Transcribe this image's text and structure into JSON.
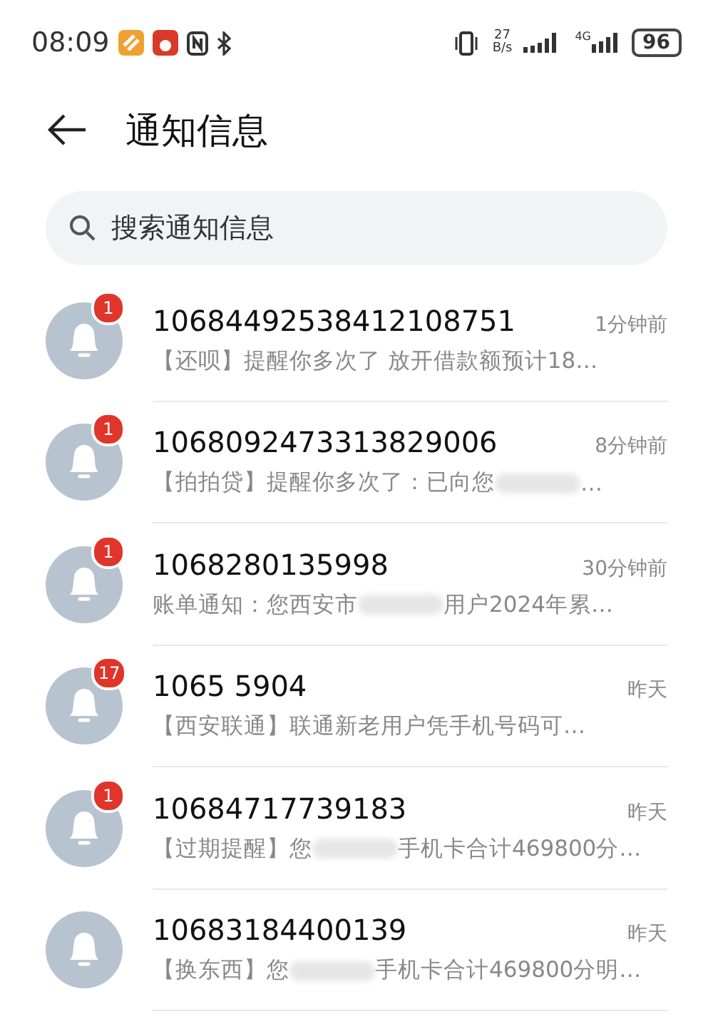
{
  "status_bar": {
    "time": "08:09",
    "net_speed_value": "27",
    "net_speed_unit": "B/s",
    "network_type": "4G",
    "battery": "96"
  },
  "header": {
    "title": "通知信息"
  },
  "search": {
    "placeholder": "搜索通知信息"
  },
  "messages": [
    {
      "sender": "10684492538412108751",
      "time": "1分钟前",
      "unread": "1",
      "preview": [
        {
          "kind": "text",
          "text": "【还呗】提醒你多次了 放开借款额预计18…"
        }
      ]
    },
    {
      "sender": "1068092473313829006",
      "time": "8分钟前",
      "unread": "1",
      "preview": [
        {
          "kind": "text",
          "text": "【拍拍贷】提醒你多次了：已向您"
        },
        {
          "kind": "blur"
        },
        {
          "kind": "text",
          "text": "…"
        }
      ]
    },
    {
      "sender": "1068280135998",
      "time": "30分钟前",
      "unread": "1",
      "preview": [
        {
          "kind": "text",
          "text": "账单通知：您西安市"
        },
        {
          "kind": "blur"
        },
        {
          "kind": "text",
          "text": "用户2024年累…"
        }
      ]
    },
    {
      "sender": "1065 5904",
      "time": "昨天",
      "unread": "17",
      "preview": [
        {
          "kind": "text",
          "text": "【西安联通】联通新老用户凭手机号码可…"
        }
      ]
    },
    {
      "sender": "10684717739183",
      "time": "昨天",
      "unread": "1",
      "preview": [
        {
          "kind": "text",
          "text": "【过期提醒】您"
        },
        {
          "kind": "blur"
        },
        {
          "kind": "text",
          "text": "手机卡合计469800分…"
        }
      ]
    },
    {
      "sender": "10683184400139",
      "time": "昨天",
      "preview": [
        {
          "kind": "text",
          "text": "【换东西】您"
        },
        {
          "kind": "blur"
        },
        {
          "kind": "text",
          "text": "手机卡合计469800分明…"
        }
      ]
    }
  ]
}
